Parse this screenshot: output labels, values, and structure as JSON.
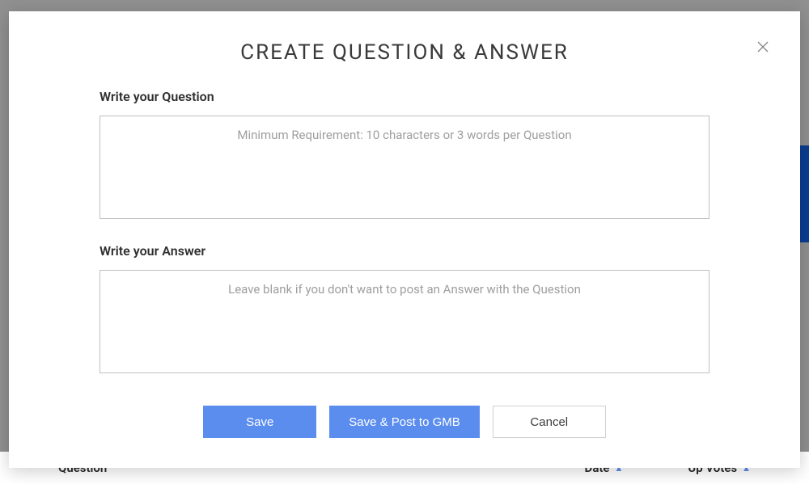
{
  "modal": {
    "title": "CREATE QUESTION & ANSWER",
    "question_label": "Write your Question",
    "question_placeholder": "Minimum Requirement: 10 characters or 3 words per Question",
    "answer_label": "Write your Answer",
    "answer_placeholder": "Leave blank if you don't want to post an Answer with the Question",
    "buttons": {
      "save": "Save",
      "save_post": "Save & Post to GMB",
      "cancel": "Cancel"
    }
  },
  "background": {
    "columns": {
      "question": "Question",
      "date": "Date",
      "upvotes": "Up Votes"
    }
  }
}
